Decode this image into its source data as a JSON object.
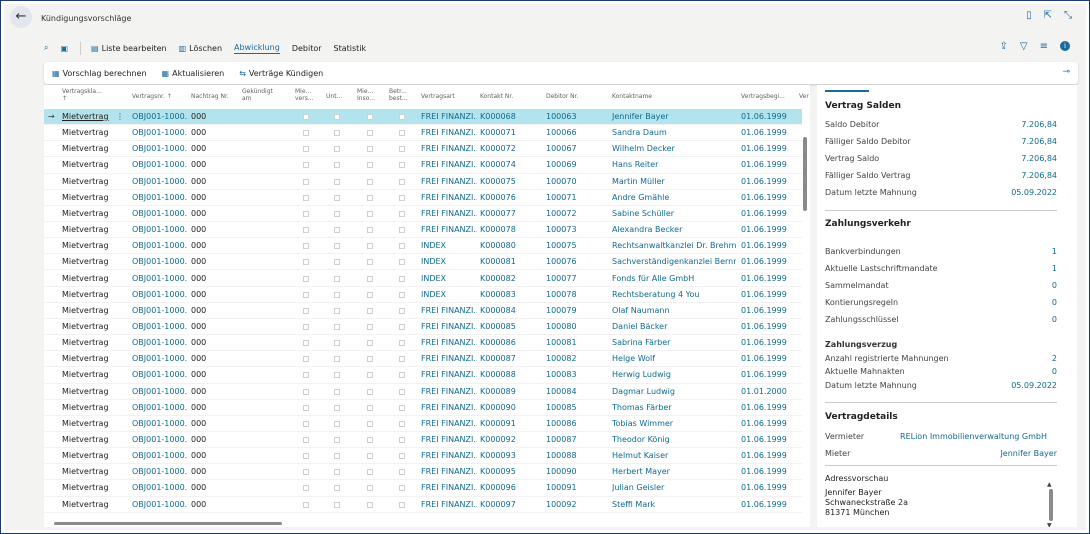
{
  "page": {
    "title": "Kündigungsvorschläge"
  },
  "actions": {
    "liste_bearbeiten": "Liste bearbeiten",
    "loeschen": "Löschen",
    "abwicklung": "Abwicklung",
    "debitor": "Debitor",
    "statistik": "Statistik"
  },
  "promoted": {
    "vorschlag": "Vorschlag berechnen",
    "aktualisieren": "Aktualisieren",
    "kuendigen": "Verträge Kündigen"
  },
  "columns": {
    "vertragsklasse": "Vertragskla...",
    "vertragsklasse_arrow": "↑",
    "vertragsnr": "Vertragsnr. ↑",
    "nachtrag": "Nachtrag Nr.",
    "gekuendigt1": "Gekündigt",
    "gekuendigt2": "am",
    "mie1_a": "Mie...",
    "mie1_b": "vers...",
    "unt": "Unt...",
    "mie2_a": "Mie...",
    "mie2_b": "Inso...",
    "betr_a": "Betr...",
    "betr_b": "best...",
    "vertragsart": "Vertragsart",
    "kontakt": "Kontakt Nr.",
    "debitor": "Debitor Nr.",
    "kontaktname": "Kontaktname",
    "vertragsbeginn": "Vertragsbegi...",
    "ver": "Ver"
  },
  "rows": [
    {
      "klasse": "Mietvertrag",
      "nr": "OBJ001-1000...",
      "nachtrag": "000",
      "art": "FREI FINANZI...",
      "kontakt": "K000068",
      "debitor": "100063",
      "name": "Jennifer Bayer",
      "beginn": "01.06.1999"
    },
    {
      "klasse": "Mietvertrag",
      "nr": "OBJ001-1000...",
      "nachtrag": "000",
      "art": "FREI FINANZI...",
      "kontakt": "K000071",
      "debitor": "100066",
      "name": "Sandra Daum",
      "beginn": "01.06.1999"
    },
    {
      "klasse": "Mietvertrag",
      "nr": "OBJ001-1000...",
      "nachtrag": "000",
      "art": "FREI FINANZI...",
      "kontakt": "K000072",
      "debitor": "100067",
      "name": "Wilhelm Decker",
      "beginn": "01.06.1999"
    },
    {
      "klasse": "Mietvertrag",
      "nr": "OBJ001-1000...",
      "nachtrag": "000",
      "art": "FREI FINANZI...",
      "kontakt": "K000074",
      "debitor": "100069",
      "name": "Hans Reiter",
      "beginn": "01.06.1999"
    },
    {
      "klasse": "Mietvertrag",
      "nr": "OBJ001-1000...",
      "nachtrag": "000",
      "art": "FREI FINANZI...",
      "kontakt": "K000075",
      "debitor": "100070",
      "name": "Martin Müller",
      "beginn": "01.06.1999"
    },
    {
      "klasse": "Mietvertrag",
      "nr": "OBJ001-1000...",
      "nachtrag": "000",
      "art": "FREI FINANZI...",
      "kontakt": "K000076",
      "debitor": "100071",
      "name": "Andre Gmähle",
      "beginn": "01.06.1999"
    },
    {
      "klasse": "Mietvertrag",
      "nr": "OBJ001-1000...",
      "nachtrag": "000",
      "art": "FREI FINANZI...",
      "kontakt": "K000077",
      "debitor": "100072",
      "name": "Sabine Schüller",
      "beginn": "01.06.1999"
    },
    {
      "klasse": "Mietvertrag",
      "nr": "OBJ001-1000...",
      "nachtrag": "000",
      "art": "FREI FINANZI...",
      "kontakt": "K000078",
      "debitor": "100073",
      "name": "Alexandra Becker",
      "beginn": "01.06.1999"
    },
    {
      "klasse": "Mietvertrag",
      "nr": "OBJ001-1000...",
      "nachtrag": "000",
      "art": "INDEX",
      "kontakt": "K000080",
      "debitor": "100075",
      "name": "Rechtsanwaltkanzlei Dr. Brehmer",
      "beginn": "01.06.1999"
    },
    {
      "klasse": "Mietvertrag",
      "nr": "OBJ001-1000...",
      "nachtrag": "000",
      "art": "INDEX",
      "kontakt": "K000081",
      "debitor": "100076",
      "name": "Sachverständigenkanzlei Bernreu...",
      "beginn": "01.06.1999"
    },
    {
      "klasse": "Mietvertrag",
      "nr": "OBJ001-1000...",
      "nachtrag": "000",
      "art": "INDEX",
      "kontakt": "K000082",
      "debitor": "100077",
      "name": "Fonds für Alle GmbH",
      "beginn": "01.06.1999"
    },
    {
      "klasse": "Mietvertrag",
      "nr": "OBJ001-1000...",
      "nachtrag": "000",
      "art": "INDEX",
      "kontakt": "K000083",
      "debitor": "100078",
      "name": "Rechtsberatung 4 You",
      "beginn": "01.06.1999"
    },
    {
      "klasse": "Mietvertrag",
      "nr": "OBJ001-1000...",
      "nachtrag": "000",
      "art": "FREI FINANZI...",
      "kontakt": "K000084",
      "debitor": "100079",
      "name": "Olaf Naumann",
      "beginn": "01.06.1999"
    },
    {
      "klasse": "Mietvertrag",
      "nr": "OBJ001-1000...",
      "nachtrag": "000",
      "art": "FREI FINANZI...",
      "kontakt": "K000085",
      "debitor": "100080",
      "name": "Daniel Bäcker",
      "beginn": "01.06.1999"
    },
    {
      "klasse": "Mietvertrag",
      "nr": "OBJ001-1000...",
      "nachtrag": "000",
      "art": "FREI FINANZI...",
      "kontakt": "K000086",
      "debitor": "100081",
      "name": "Sabrina Färber",
      "beginn": "01.06.1999"
    },
    {
      "klasse": "Mietvertrag",
      "nr": "OBJ001-1000...",
      "nachtrag": "000",
      "art": "FREI FINANZI...",
      "kontakt": "K000087",
      "debitor": "100082",
      "name": "Helge Wolf",
      "beginn": "01.06.1999"
    },
    {
      "klasse": "Mietvertrag",
      "nr": "OBJ001-1000...",
      "nachtrag": "000",
      "art": "FREI FINANZI...",
      "kontakt": "K000088",
      "debitor": "100083",
      "name": "Herwig Ludwig",
      "beginn": "01.06.1999"
    },
    {
      "klasse": "Mietvertrag",
      "nr": "OBJ001-1000...",
      "nachtrag": "000",
      "art": "FREI FINANZI...",
      "kontakt": "K000089",
      "debitor": "100084",
      "name": "Dagmar Ludwig",
      "beginn": "01.01.2000"
    },
    {
      "klasse": "Mietvertrag",
      "nr": "OBJ001-1000...",
      "nachtrag": "000",
      "art": "FREI FINANZI...",
      "kontakt": "K000090",
      "debitor": "100085",
      "name": "Thomas Färber",
      "beginn": "01.06.1999"
    },
    {
      "klasse": "Mietvertrag",
      "nr": "OBJ001-1000...",
      "nachtrag": "000",
      "art": "FREI FINANZI...",
      "kontakt": "K000091",
      "debitor": "100086",
      "name": "Tobias Wimmer",
      "beginn": "01.06.1999"
    },
    {
      "klasse": "Mietvertrag",
      "nr": "OBJ001-1000...",
      "nachtrag": "000",
      "art": "FREI FINANZI...",
      "kontakt": "K000092",
      "debitor": "100087",
      "name": "Theodor König",
      "beginn": "01.06.1999"
    },
    {
      "klasse": "Mietvertrag",
      "nr": "OBJ001-1000...",
      "nachtrag": "000",
      "art": "FREI FINANZI...",
      "kontakt": "K000093",
      "debitor": "100088",
      "name": "Helmut Kaiser",
      "beginn": "01.06.1999"
    },
    {
      "klasse": "Mietvertrag",
      "nr": "OBJ001-1000...",
      "nachtrag": "000",
      "art": "FREI FINANZI...",
      "kontakt": "K000095",
      "debitor": "100090",
      "name": "Herbert Mayer",
      "beginn": "01.06.1999"
    },
    {
      "klasse": "Mietvertrag",
      "nr": "OBJ001-1000...",
      "nachtrag": "000",
      "art": "FREI FINANZI...",
      "kontakt": "K000096",
      "debitor": "100091",
      "name": "Julian Geisler",
      "beginn": "01.06.1999"
    },
    {
      "klasse": "Mietvertrag",
      "nr": "OBJ001-1000...",
      "nachtrag": "000",
      "art": "FREI FINANZI...",
      "kontakt": "K000097",
      "debitor": "100092",
      "name": "Steffi Mark",
      "beginn": "01.06.1999"
    }
  ],
  "factbox": {
    "salden": {
      "title": "Vertrag Salden",
      "rows": [
        {
          "label": "Saldo Debitor",
          "value": "7.206,84"
        },
        {
          "label": "Fälliger Saldo Debitor",
          "value": "7.206,84"
        },
        {
          "label": "Vertrag Saldo",
          "value": "7.206,84"
        },
        {
          "label": "Fälliger Saldo Vertrag",
          "value": "7.206,84"
        },
        {
          "label": "Datum letzte Mahnung",
          "value": "05.09.2022"
        }
      ]
    },
    "zahlung": {
      "title": "Zahlungsverkehr",
      "rows": [
        {
          "label": "Bankverbindungen",
          "value": "1"
        },
        {
          "label": "Aktuelle Lastschriftmandate",
          "value": "1"
        },
        {
          "label": "Sammelmandat",
          "value": "0"
        },
        {
          "label": "Kontierungsregeln",
          "value": "0"
        },
        {
          "label": "Zahlungsschlüssel",
          "value": "0"
        }
      ]
    },
    "verzug": {
      "title": "Zahlungsverzug",
      "rows": [
        {
          "label": "Anzahl registrierte Mahnungen",
          "value": "2"
        },
        {
          "label": "Aktuelle Mahnakten",
          "value": "0"
        },
        {
          "label": "Datum letzte Mahnung",
          "value": "05.09.2022"
        }
      ]
    },
    "details": {
      "title": "Vertragdetails",
      "vermieter_label": "Vermieter",
      "vermieter": "RELion Immobilienverwaltung GmbH",
      "mieter_label": "Mieter",
      "mieter": "Jennifer Bayer",
      "adresse_label": "Adressvorschau",
      "adresse": [
        "Jennifer Bayer",
        "Schwaneckstraße 2a",
        "81371 München"
      ]
    }
  },
  "colors": {
    "accent": "#1a6aa0",
    "link": "#0f6a8e",
    "selected": "#b3e3ec"
  }
}
